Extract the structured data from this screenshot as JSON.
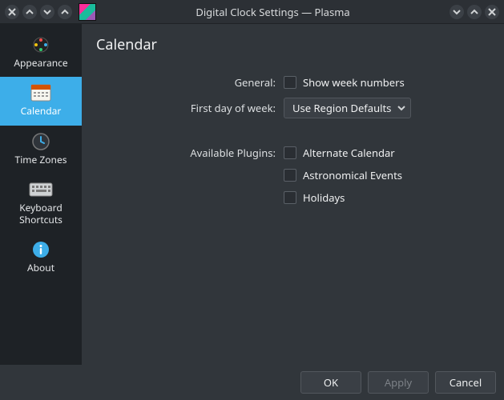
{
  "window": {
    "title": "Digital Clock Settings — Plasma"
  },
  "sidebar": {
    "items": [
      {
        "label": "Appearance"
      },
      {
        "label": "Calendar"
      },
      {
        "label": "Time Zones"
      },
      {
        "label": "Keyboard Shortcuts"
      },
      {
        "label": "About"
      }
    ],
    "selected_index": 1
  },
  "page": {
    "title": "Calendar",
    "general_label": "General:",
    "show_week_numbers": "Show week numbers",
    "first_day_label": "First day of week:",
    "first_day_value": "Use Region Defaults",
    "plugins_label": "Available Plugins:",
    "plugins": [
      "Alternate Calendar",
      "Astronomical Events",
      "Holidays"
    ]
  },
  "footer": {
    "ok": "OK",
    "apply": "Apply",
    "cancel": "Cancel"
  }
}
